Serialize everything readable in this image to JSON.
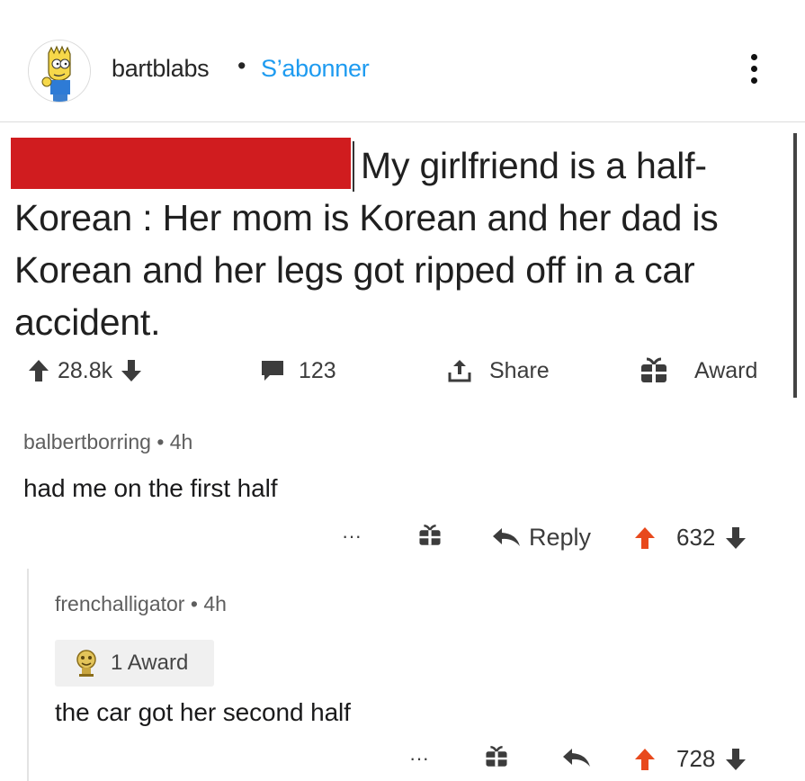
{
  "header": {
    "username": "bartblabs",
    "separator": "•",
    "follow_label": "S’abonner",
    "avatar_icon": "bart-simpson-avatar",
    "more_icon": "more-vertical-icon"
  },
  "post": {
    "text": "My girlfriend is a half-Korean : Her mom is Korean and her dad is Korean and her legs got ripped off in a car accident.",
    "redacted_color": "#d01c1f",
    "upvotes": "28.8k",
    "comments": "123",
    "share_label": "Share",
    "award_label": "Award"
  },
  "comments": [
    {
      "author": "balbertborring",
      "age": "4h",
      "text": "had me on the first half",
      "more": "···",
      "reply_label": "Reply",
      "score": "632"
    },
    {
      "author": "frenchalligator",
      "age": "4h",
      "award_badge": "1 Award",
      "text": "the car got her second half",
      "more": "···",
      "score": "728"
    }
  ],
  "colors": {
    "accent_blue": "#1e9bf0",
    "upvote_orange": "#e8491c",
    "text": "#1a1a1b"
  }
}
